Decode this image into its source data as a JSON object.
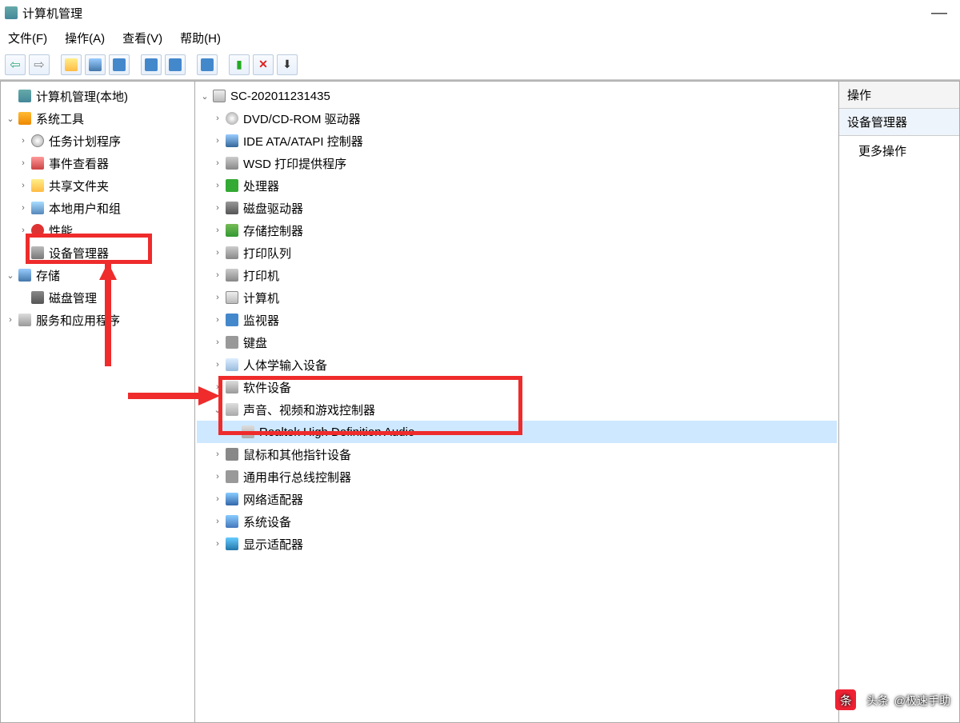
{
  "window": {
    "title": "计算机管理"
  },
  "menu": {
    "file": "文件(F)",
    "action": "操作(A)",
    "view": "查看(V)",
    "help": "帮助(H)"
  },
  "left_tree": {
    "root": "计算机管理(本地)",
    "system_tools": "系统工具",
    "task_scheduler": "任务计划程序",
    "event_viewer": "事件查看器",
    "shared_folders": "共享文件夹",
    "local_users": "本地用户和组",
    "performance": "性能",
    "device_manager": "设备管理器",
    "storage": "存储",
    "disk_mgmt": "磁盘管理",
    "services_apps": "服务和应用程序"
  },
  "center_tree": {
    "root": "SC-202011231435",
    "dvd": "DVD/CD-ROM 驱动器",
    "ide": "IDE ATA/ATAPI 控制器",
    "wsd": "WSD 打印提供程序",
    "cpu": "处理器",
    "disk_drives": "磁盘驱动器",
    "storage_ctrl": "存储控制器",
    "print_queue": "打印队列",
    "printers": "打印机",
    "computer": "计算机",
    "monitor": "监视器",
    "keyboard": "键盘",
    "hid": "人体学输入设备",
    "software_dev": "软件设备",
    "sound": "声音、视频和游戏控制器",
    "sound_child": "Realtek High Definition Audio",
    "mouse": "鼠标和其他指针设备",
    "usb": "通用串行总线控制器",
    "network": "网络适配器",
    "system_dev": "系统设备",
    "display": "显示适配器"
  },
  "right_pane": {
    "header": "操作",
    "section": "设备管理器",
    "more": "更多操作"
  },
  "watermark": {
    "prefix": "头条",
    "text": "@极速手助"
  }
}
